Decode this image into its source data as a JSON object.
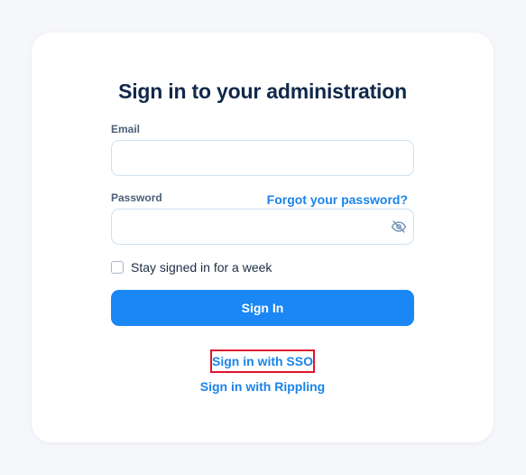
{
  "form": {
    "title": "Sign in to your administration",
    "email_label": "Email",
    "email_value": "",
    "password_label": "Password",
    "password_value": "",
    "forgot_password_link": "Forgot your password?",
    "password_visibility_icon": "eye-off-icon",
    "remember_label": "Stay signed in for a week",
    "remember_checked": false,
    "sign_in_button": "Sign In",
    "sso_link": "Sign in with SSO",
    "rippling_link": "Sign in with Rippling"
  },
  "colors": {
    "background": "#f6f7fb",
    "card": "#ffffff",
    "title": "#11284a",
    "accent": "#1a87f5",
    "link": "#1a84e8",
    "highlight_border": "#e0142e",
    "input_border": "#cfe0ef"
  }
}
